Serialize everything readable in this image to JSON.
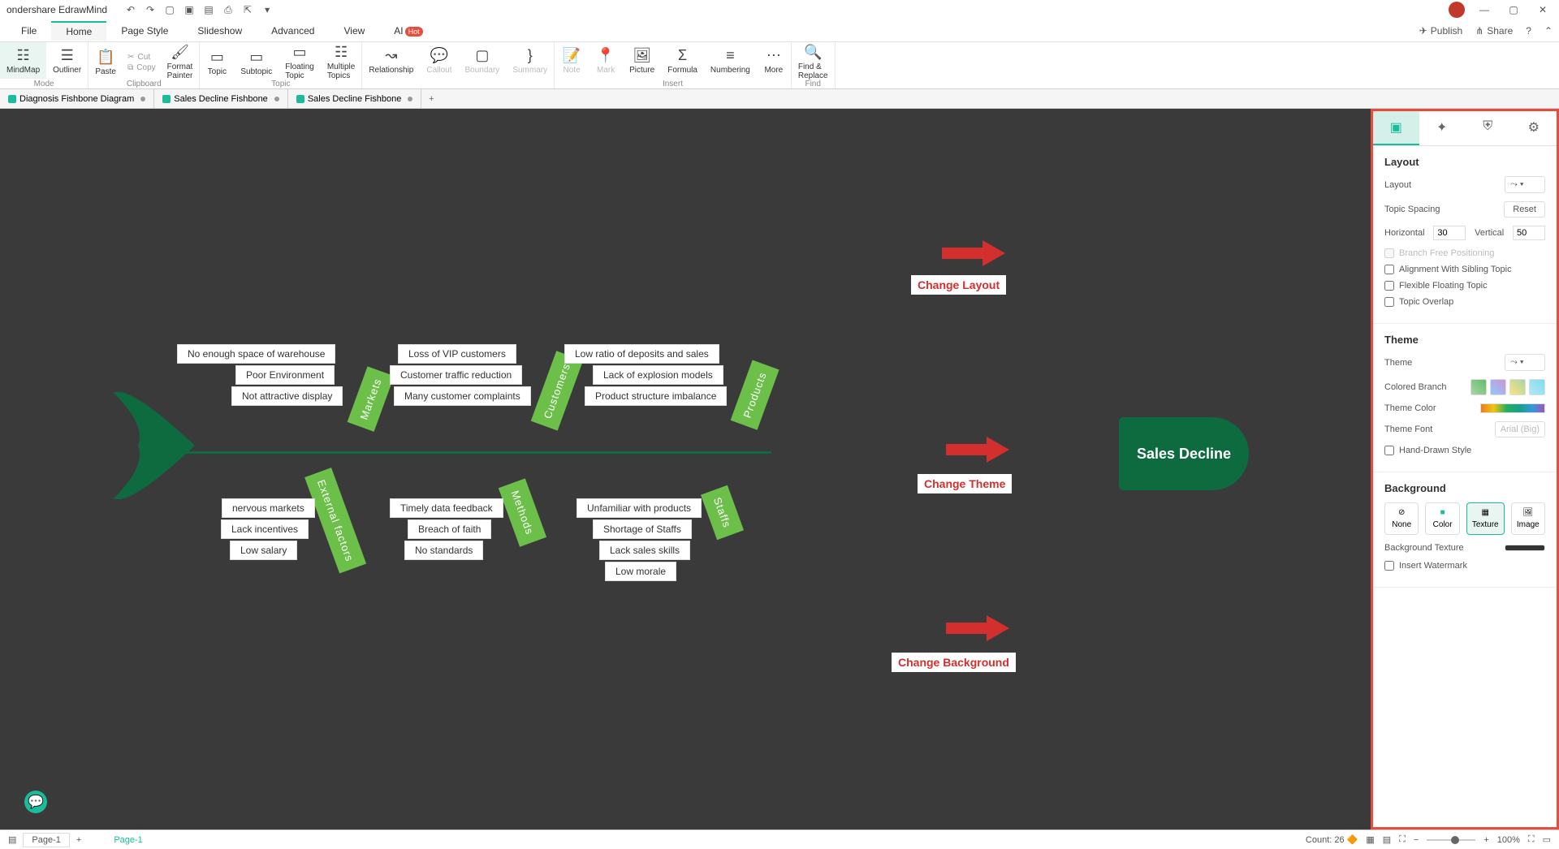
{
  "app": {
    "title": "ondershare EdrawMind"
  },
  "menu": {
    "items": [
      "File",
      "Home",
      "Page Style",
      "Slideshow",
      "Advanced",
      "View"
    ],
    "ai": "AI",
    "ai_badge": "Hot",
    "publish": "Publish",
    "share": "Share"
  },
  "ribbon": {
    "mode": {
      "label": "Mode",
      "mindmap": "MindMap",
      "outliner": "Outliner"
    },
    "clipboard": {
      "label": "Clipboard",
      "paste": "Paste",
      "cut": "Cut",
      "copy": "Copy",
      "painter": "Format\nPainter"
    },
    "topic": {
      "label": "Topic",
      "topic": "Topic",
      "subtopic": "Subtopic",
      "floating": "Floating\nTopic",
      "multiple": "Multiple\nTopics"
    },
    "relationship": "Relationship",
    "callout": "Callout",
    "boundary": "Boundary",
    "summary": "Summary",
    "insert": {
      "label": "Insert",
      "note": "Note",
      "mark": "Mark",
      "picture": "Picture",
      "formula": "Formula",
      "numbering": "Numbering",
      "more": "More"
    },
    "find": {
      "label": "Find",
      "findreplace": "Find &\nReplace"
    }
  },
  "tabs": [
    "Diagnosis Fishbone Diagram",
    "Sales Decline Fishbone",
    "Sales Decline Fishbone"
  ],
  "fishbone": {
    "head": "Sales Decline",
    "bones": {
      "markets": {
        "label": "Markets",
        "causes": [
          "No enough space of warehouse",
          "Poor Environment",
          "Not attractive display"
        ]
      },
      "customers": {
        "label": "Customers",
        "causes": [
          "Loss of VIP customers",
          "Customer traffic reduction",
          "Many customer complaints"
        ]
      },
      "products": {
        "label": "Products",
        "causes": [
          "Low ratio of deposits and sales",
          "Lack of explosion models",
          "Product structure imbalance"
        ]
      },
      "external": {
        "label": "External factors",
        "causes": [
          "nervous markets",
          "Lack incentives",
          "Low salary"
        ]
      },
      "methods": {
        "label": "Methods",
        "causes": [
          "Timely data feedback",
          "Breach of faith",
          "No standards"
        ]
      },
      "staffs": {
        "label": "Staffs",
        "causes": [
          "Unfamiliar with products",
          "Shortage of Staffs",
          "Lack sales skills",
          "Low morale"
        ]
      }
    }
  },
  "annotations": {
    "layout": "Change Layout",
    "theme": "Change Theme",
    "background": "Change Background"
  },
  "panel": {
    "layout": {
      "title": "Layout",
      "layout_lbl": "Layout",
      "spacing": "Topic Spacing",
      "reset": "Reset",
      "horizontal": "Horizontal",
      "horizontal_val": "30",
      "vertical": "Vertical",
      "vertical_val": "50",
      "branch_free": "Branch Free Positioning",
      "align_sibling": "Alignment With Sibling Topic",
      "flexible": "Flexible Floating Topic",
      "overlap": "Topic Overlap"
    },
    "theme": {
      "title": "Theme",
      "theme_lbl": "Theme",
      "colored_branch": "Colored Branch",
      "theme_color": "Theme Color",
      "theme_font": "Theme Font",
      "font_placeholder": "Arial (Big)",
      "handdrawn": "Hand-Drawn Style"
    },
    "background": {
      "title": "Background",
      "none": "None",
      "color": "Color",
      "texture": "Texture",
      "image": "Image",
      "bg_texture": "Background Texture",
      "watermark": "Insert Watermark"
    }
  },
  "status": {
    "page": "Page-1",
    "page_btn": "Page-1",
    "count": "Count: 26",
    "zoom": "100%"
  }
}
